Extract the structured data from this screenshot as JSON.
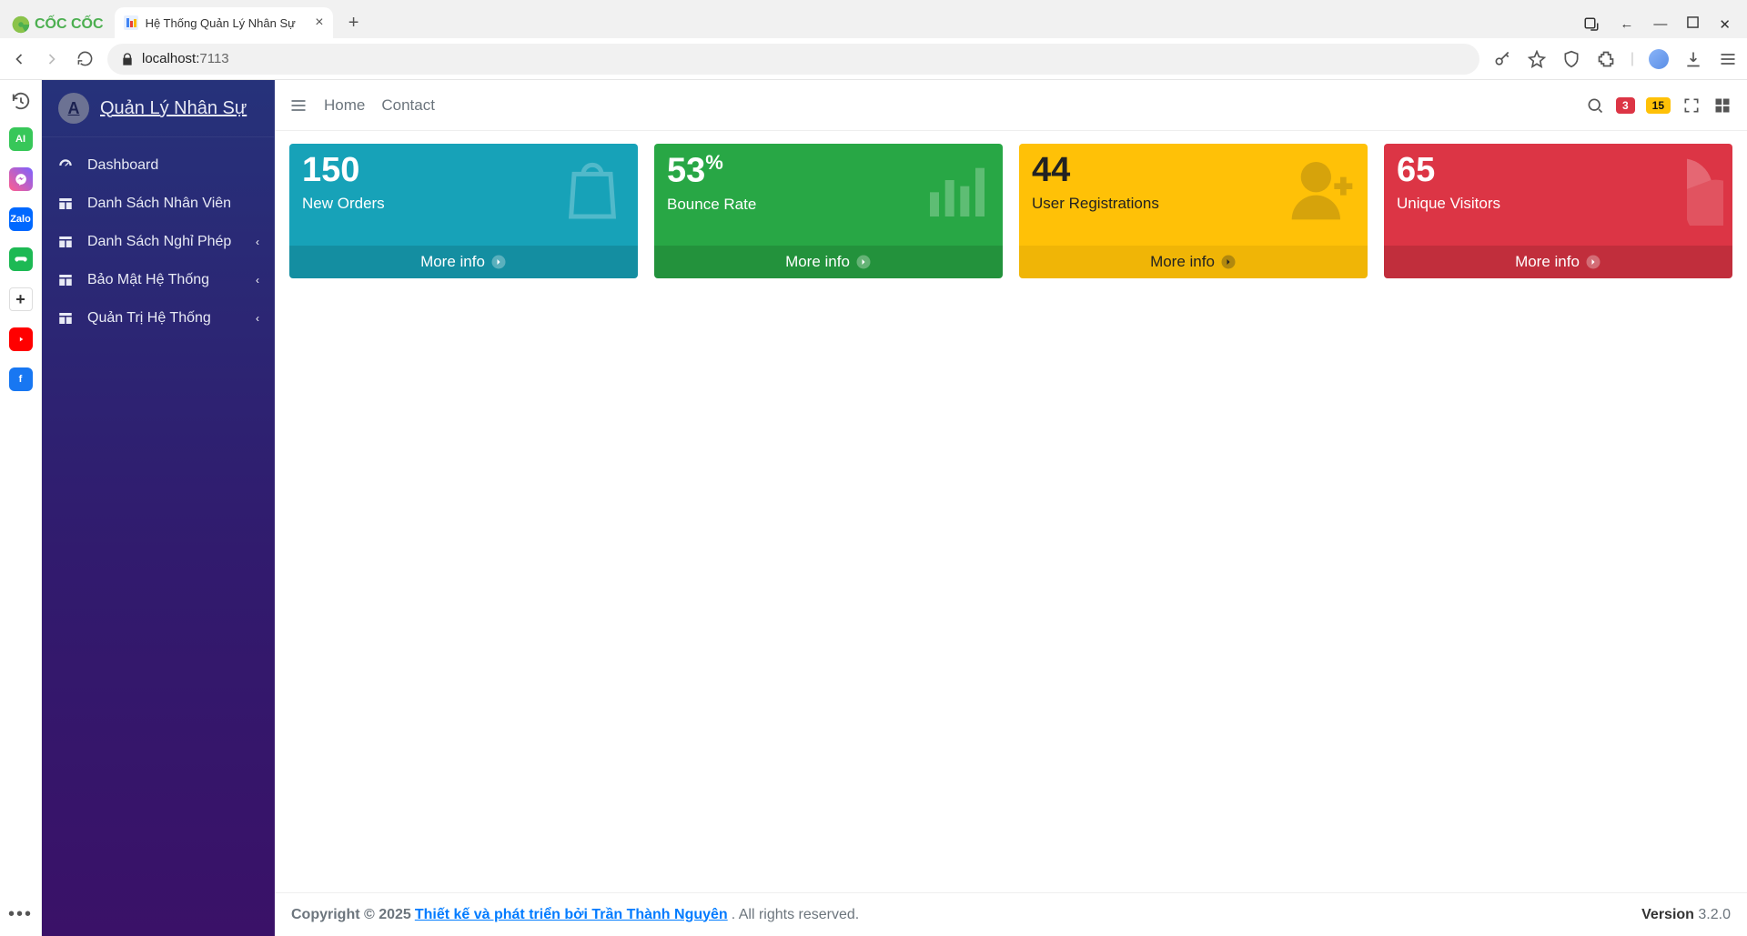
{
  "browser": {
    "logo_text": "CỐC CỐC",
    "tab_title": "Hệ Thống Quản Lý Nhân Sự",
    "url_host": "localhost:",
    "url_port": "7113"
  },
  "sidebar": {
    "brand": "Quản Lý Nhân Sự",
    "items": [
      {
        "label": "Dashboard",
        "icon": "dashboard-icon",
        "has_children": false
      },
      {
        "label": "Danh Sách Nhân Viên",
        "icon": "table-icon",
        "has_children": false
      },
      {
        "label": "Danh Sách Nghỉ Phép",
        "icon": "table-icon",
        "has_children": true
      },
      {
        "label": "Bảo Mật Hệ Thống",
        "icon": "table-icon",
        "has_children": true
      },
      {
        "label": "Quản Trị Hệ Thống",
        "icon": "table-icon",
        "has_children": true
      }
    ]
  },
  "topbar": {
    "nav": [
      "Home",
      "Contact"
    ],
    "badge_red": "3",
    "badge_yellow": "15"
  },
  "cards": [
    {
      "value": "150",
      "suffix": "",
      "label": "New Orders",
      "more": "More info",
      "color": "c-cyan",
      "icon": "bag"
    },
    {
      "value": "53",
      "suffix": "%",
      "label": "Bounce Rate",
      "more": "More info",
      "color": "c-green",
      "icon": "bars"
    },
    {
      "value": "44",
      "suffix": "",
      "label": "User Registrations",
      "more": "More info",
      "color": "c-yel",
      "icon": "user-plus"
    },
    {
      "value": "65",
      "suffix": "",
      "label": "Unique Visitors",
      "more": "More info",
      "color": "c-red",
      "icon": "pie"
    }
  ],
  "footer": {
    "copyright": "Copyright © 2025",
    "link": "Thiết kế và phát triển bởi Trần Thành Nguyên",
    "suffix": ". All rights reserved.",
    "version_label": "Version",
    "version": "3.2.0"
  }
}
